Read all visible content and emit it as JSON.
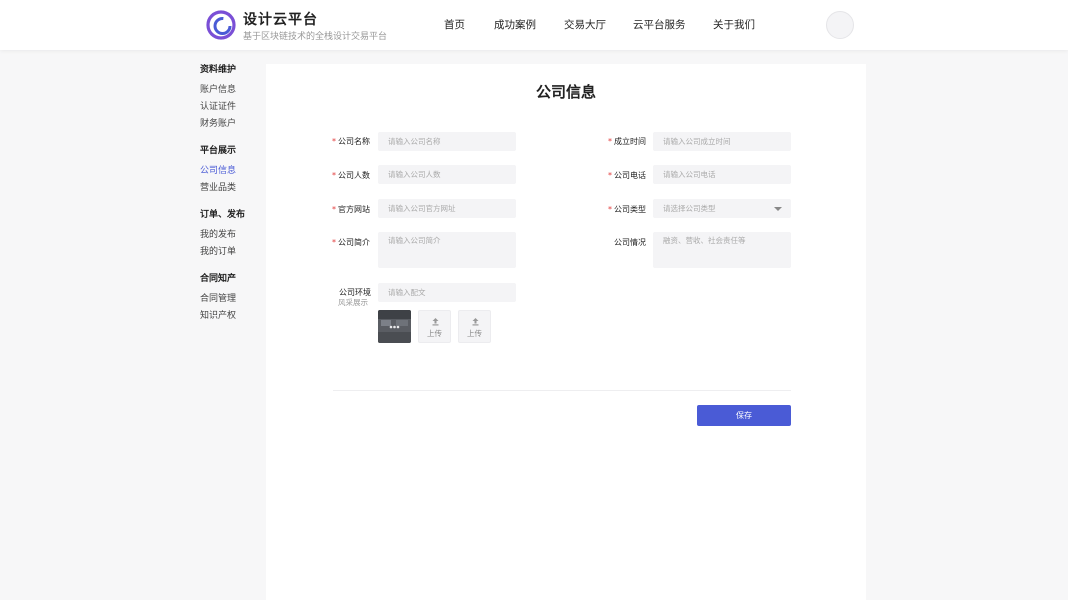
{
  "brand": {
    "title": "设计云平台",
    "subtitle": "基于区块链技术的全栈设计交易平台"
  },
  "nav": [
    {
      "label": "首页"
    },
    {
      "label": "成功案例"
    },
    {
      "label": "交易大厅"
    },
    {
      "label": "云平台服务"
    },
    {
      "label": "关于我们"
    }
  ],
  "sidebar": {
    "groups": [
      {
        "title": "资料维护",
        "items": [
          "账户信息",
          "认证证件",
          "财务账户"
        ]
      },
      {
        "title": "平台展示",
        "items": [
          "公司信息",
          "营业品类"
        ]
      },
      {
        "title": "订单、发布",
        "items": [
          "我的发布",
          "我的订单"
        ]
      },
      {
        "title": "合同知产",
        "items": [
          "合同管理",
          "知识产权"
        ]
      }
    ],
    "active_item": "公司信息"
  },
  "colors": {
    "accent": "#4a5bd6",
    "required": "#e23b3b"
  },
  "form": {
    "title": "公司信息",
    "required_mark": "*",
    "company_name": {
      "label": "公司名称",
      "placeholder": "请输入公司名称"
    },
    "founded": {
      "label": "成立时间",
      "placeholder": "请输入公司成立时间"
    },
    "headcount": {
      "label": "公司人数",
      "placeholder": "请输入公司人数"
    },
    "phone": {
      "label": "公司电话",
      "placeholder": "请输入公司电话"
    },
    "website": {
      "label": "官方网站",
      "placeholder": "请输入公司官方网址"
    },
    "company_type": {
      "label": "公司类型",
      "placeholder": "请选择公司类型"
    },
    "intro": {
      "label": "公司简介",
      "placeholder": "请输入公司简介"
    },
    "situation": {
      "label": "公司情况",
      "placeholder": "融资、营收、社会责任等"
    },
    "environment": {
      "label": "公司环境",
      "sublabel": "风采展示",
      "placeholder": "请输入配文"
    },
    "upload_label": "上传",
    "save_label": "保存"
  }
}
